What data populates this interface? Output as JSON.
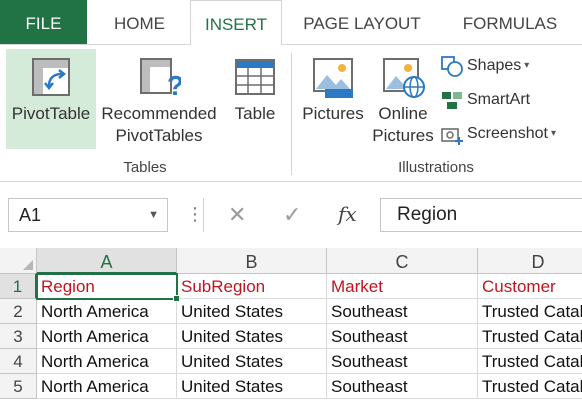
{
  "ribbon": {
    "tabs": [
      {
        "id": "file",
        "label": "FILE"
      },
      {
        "id": "home",
        "label": "HOME"
      },
      {
        "id": "insert",
        "label": "INSERT"
      },
      {
        "id": "pagelayout",
        "label": "PAGE LAYOUT"
      },
      {
        "id": "formulas",
        "label": "FORMULAS"
      }
    ],
    "active_tab": "INSERT",
    "groups": {
      "tables": {
        "label": "Tables",
        "buttons": {
          "pivot": {
            "label": "PivotTable",
            "icon": "pivot-table-icon"
          },
          "recommended": {
            "label_line1": "Recommended",
            "label_line2": "PivotTables",
            "icon": "recommended-pivot-icon"
          },
          "table": {
            "label": "Table",
            "icon": "table-icon"
          }
        }
      },
      "illustrations": {
        "label": "Illustrations",
        "buttons": {
          "pictures": {
            "label": "Pictures",
            "icon": "pictures-icon"
          },
          "online": {
            "label_line1": "Online",
            "label_line2": "Pictures",
            "icon": "online-pictures-icon"
          },
          "shapes": {
            "label": "Shapes",
            "icon": "shapes-icon"
          },
          "smartart": {
            "label": "SmartArt",
            "icon": "smartart-icon"
          },
          "screenshot": {
            "label": "Screenshot",
            "icon": "screenshot-icon"
          }
        }
      }
    }
  },
  "formula_bar": {
    "name_box": "A1",
    "cancel_symbol": "✕",
    "enter_symbol": "✓",
    "fx_symbol": "fx",
    "content": "Region"
  },
  "sheet": {
    "columns": [
      "A",
      "B",
      "C",
      "D"
    ],
    "selected_column": "A",
    "selected_row": 1,
    "rows": [
      {
        "num": "1",
        "cells": [
          "Region",
          "SubRegion",
          "Market",
          "Customer"
        ]
      },
      {
        "num": "2",
        "cells": [
          "North America",
          "United States",
          "Southeast",
          "Trusted Catalog"
        ]
      },
      {
        "num": "3",
        "cells": [
          "North America",
          "United States",
          "Southeast",
          "Trusted Catalog"
        ]
      },
      {
        "num": "4",
        "cells": [
          "North America",
          "United States",
          "Southeast",
          "Trusted Catalog"
        ]
      },
      {
        "num": "5",
        "cells": [
          "North America",
          "United States",
          "Southeast",
          "Trusted Catalog"
        ]
      }
    ]
  },
  "colors": {
    "accent": "#217346",
    "header_text": "#c0151f",
    "pivot_highlight": "#d5ebd9"
  }
}
